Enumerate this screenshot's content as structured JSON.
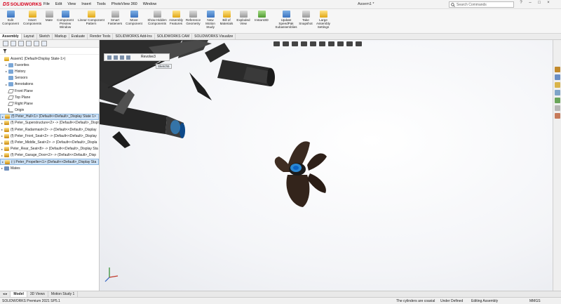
{
  "app": {
    "logo_prefix": "DS",
    "logo_name": "SOLIDWORKS",
    "document_title": "Assem1 *"
  },
  "menu": [
    "File",
    "Edit",
    "View",
    "Insert",
    "Tools",
    "PhotoView 360",
    "Window"
  ],
  "search": {
    "placeholder": "Search Commands"
  },
  "ribbon": [
    {
      "label": "Edit Component",
      "icon": "edit-component-icon"
    },
    {
      "label": "Insert Components",
      "icon": "insert-components-icon"
    },
    {
      "label": "Mate",
      "icon": "mate-icon"
    },
    {
      "label": "Component Preview Window",
      "icon": "preview-window-icon"
    },
    {
      "label": "Linear Component Pattern",
      "icon": "pattern-icon"
    },
    {
      "label": "Smart Fasteners",
      "icon": "fastener-icon"
    },
    {
      "label": "Move Component",
      "icon": "move-component-icon"
    },
    {
      "label": "Show Hidden Components",
      "icon": "show-hidden-icon"
    },
    {
      "label": "Assembly Features",
      "icon": "assembly-features-icon"
    },
    {
      "label": "Reference Geometry",
      "icon": "reference-geometry-icon"
    },
    {
      "label": "New Motion Study",
      "icon": "motion-study-icon"
    },
    {
      "label": "Bill of Materials",
      "icon": "bom-icon"
    },
    {
      "label": "Exploded View",
      "icon": "exploded-view-icon"
    },
    {
      "label": "Instant3D",
      "icon": "instant3d-icon"
    },
    {
      "label": "Update SpeedPak Subassemblies",
      "icon": "speedpak-icon"
    },
    {
      "label": "Take Snapshot",
      "icon": "snapshot-icon"
    },
    {
      "label": "Large Assembly Settings",
      "icon": "large-assembly-icon"
    }
  ],
  "command_tabs": [
    "Assembly",
    "Layout",
    "Sketch",
    "Markup",
    "Evaluate",
    "Render Tools",
    "SOLIDWORKS Add-Ins",
    "SOLIDWORKS CAM",
    "SOLIDWORKS Visualize"
  ],
  "tree": {
    "root": "Assem1  (Default<Display State-1>)",
    "items": [
      {
        "label": "Favorites",
        "icon": "folder-icon"
      },
      {
        "label": "History",
        "icon": "history-icon"
      },
      {
        "label": "Sensors",
        "icon": "sensor-icon"
      },
      {
        "label": "Annotations",
        "icon": "annotations-icon"
      },
      {
        "label": "Front Plane",
        "icon": "plane-icon"
      },
      {
        "label": "Top Plane",
        "icon": "plane-icon"
      },
      {
        "label": "Right Plane",
        "icon": "plane-icon"
      },
      {
        "label": "Origin",
        "icon": "origin-icon"
      },
      {
        "label": "(f) Peter_Hull<1> (Default<<Default>_Display State 1>",
        "icon": "part-icon",
        "selected": true
      },
      {
        "label": "(f) Peter_Superstructure<2> -> (Default<<Default>_Displ",
        "icon": "part-icon"
      },
      {
        "label": "(f) Peter_Radarmast<2> -> (Default<<Default>_Display",
        "icon": "part-icon"
      },
      {
        "label": "(f) Peter_Front_Seat<2> -> (Default<<Default>_Display",
        "icon": "part-icon"
      },
      {
        "label": "(f) Peter_Middle_Seat<2> -> (Default<<Default>_Displa",
        "icon": "part-icon"
      },
      {
        "label": "Peter_Rear_Seat<8> -> (Default<<Default>_Display Sta",
        "icon": "part-icon"
      },
      {
        "label": "(f) Peter_Garage_Door<2> -> (Default<<Default>_Disp",
        "icon": "part-icon"
      },
      {
        "label": "(-) Peter_Propeller<1> (Default<<Default>_Display Sta",
        "icon": "part-icon",
        "selected": true
      },
      {
        "label": "Mates",
        "icon": "mates-icon"
      }
    ]
  },
  "graphics": {
    "context_feature": "Revolve3",
    "context_sketch": "Sketch5"
  },
  "bottom_tabs": [
    "Model",
    "3D Views",
    "Motion Study 1"
  ],
  "status": {
    "product": "SOLIDWORKS Premium 2021 SP5.1",
    "message": "The cylinders are coaxial",
    "definition": "Under Defined",
    "mode": "Editing Assembly",
    "units": "MMGS"
  },
  "colors": {
    "accent_red": "#d6001c",
    "selection": "#cfe3f7",
    "highlight_cyan": "#2fa3ff"
  }
}
